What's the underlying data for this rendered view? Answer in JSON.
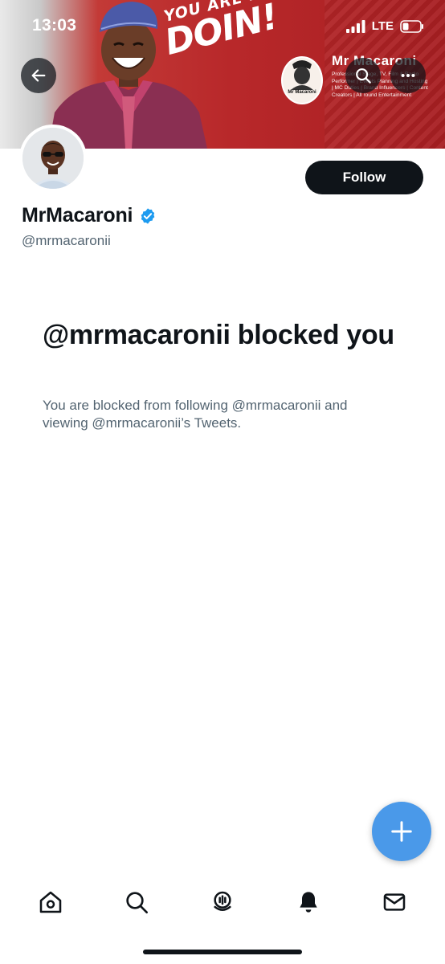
{
  "status_bar": {
    "time": "13:03",
    "network": "LTE"
  },
  "banner": {
    "slogan_small": "YOU ARE DOING WELL",
    "slogan_big": "DOIN!",
    "logo_text": "Mr Macaroni",
    "brand_title": "Mr Macaroni",
    "brand_tagline": "Professional Stage, TV, Film & Radio Performer | Events Planning and Hosting | MC Duties | Brand Influencers | Content Creators | All round Entertainment",
    "colors": {
      "primary": "#b8282a",
      "left_fade": "#e9e9e9"
    }
  },
  "header": {
    "back_icon": "arrow-left-icon",
    "search_icon": "search-icon",
    "more_icon": "more-horizontal-icon"
  },
  "profile": {
    "display_name": "MrMacaroni",
    "handle": "@mrmacaronii",
    "follow_label": "Follow",
    "verified": true
  },
  "blocked": {
    "title": "@mrmacaronii blocked you",
    "description": "You are blocked from following @mrmacaronii and viewing @mrmacaronii’s Tweets."
  },
  "fab": {
    "icon": "plus-icon"
  },
  "bottom_nav": {
    "items": [
      {
        "id": "home",
        "icon": "home-icon",
        "active": false
      },
      {
        "id": "search",
        "icon": "search-icon",
        "active": false
      },
      {
        "id": "spaces",
        "icon": "spaces-icon",
        "active": false
      },
      {
        "id": "notifications",
        "icon": "bell-icon",
        "active": true
      },
      {
        "id": "messages",
        "icon": "mail-icon",
        "active": false
      }
    ]
  },
  "colors": {
    "text_primary": "#0f1419",
    "text_secondary": "#536471",
    "accent": "#1d9bf0",
    "fab": "#4a99e9"
  }
}
